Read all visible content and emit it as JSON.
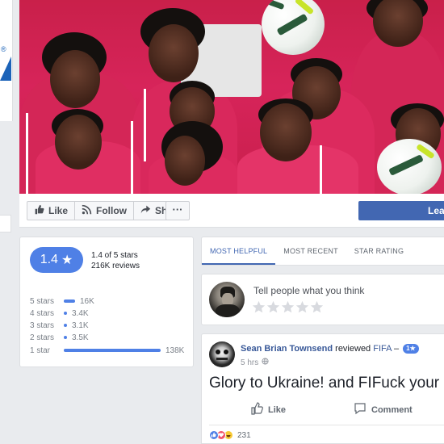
{
  "header": {
    "profile_mark": "®"
  },
  "actions": {
    "like_label": "Like",
    "follow_label": "Follow",
    "share_label": "Share",
    "more_label": "···",
    "cta_label": "Lea"
  },
  "rating": {
    "score": "1.4",
    "of_text": "1.4 of 5 stars",
    "count_text": "216K reviews",
    "distribution": [
      {
        "label": "5 stars",
        "count": "16K",
        "fraction": 0.116
      },
      {
        "label": "4 stars",
        "count": "3.4K",
        "fraction": 0.025
      },
      {
        "label": "3 stars",
        "count": "3.1K",
        "fraction": 0.022
      },
      {
        "label": "2 stars",
        "count": "3.5K",
        "fraction": 0.025
      },
      {
        "label": "1 star",
        "count": "138K",
        "fraction": 1.0
      }
    ],
    "accent_color": "#4f80e6"
  },
  "tabs": [
    {
      "label": "MOST HELPFUL",
      "active": true
    },
    {
      "label": "MOST RECENT",
      "active": false
    },
    {
      "label": "STAR RATING",
      "active": false
    }
  ],
  "composer": {
    "prompt": "Tell people what you think",
    "empty_star_icon": "star-outline-icon"
  },
  "review": {
    "author": "Sean Brian Townsend",
    "verb": "reviewed",
    "page": "FIFA",
    "dash": "–",
    "rating_badge": "1★",
    "time": "5 hrs",
    "privacy_icon": "globe-icon",
    "text": "Glory to Ukraine! and FIFuck your",
    "like_label": "Like",
    "comment_label": "Comment",
    "reaction_count": "231",
    "reactions": [
      "like-reaction-icon",
      "love-reaction-icon",
      "haha-reaction-icon"
    ]
  },
  "colors": {
    "brand": "#4267b2",
    "link": "#385898",
    "page_bg": "#e9ebee"
  }
}
